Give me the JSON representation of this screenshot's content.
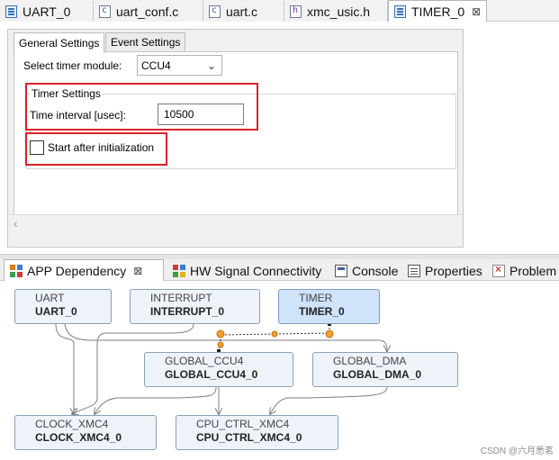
{
  "editor_tabs": [
    {
      "label": "UART_0",
      "icon": "app-icon"
    },
    {
      "label": "uart_conf.c",
      "icon": "c-file-icon"
    },
    {
      "label": "uart.c",
      "icon": "c-file-icon"
    },
    {
      "label": "xmc_usic.h",
      "icon": "h-file-icon"
    },
    {
      "label": "TIMER_0",
      "icon": "app-icon",
      "active": true,
      "close": "⊠"
    }
  ],
  "form": {
    "tabs": [
      "General Settings",
      "Event Settings"
    ],
    "timer_module_label": "Select timer module:",
    "timer_module_value": "CCU4",
    "group_title": "Timer Settings",
    "interval_label": "Time interval [usec]:",
    "interval_value": "10500",
    "start_label": "Start after initialization",
    "start_checked": false,
    "highlight_color": "#d9222a"
  },
  "view_tabs": [
    {
      "label": "APP Dependency",
      "close": "⊠",
      "icon": "app-dependency-icon",
      "active": true
    },
    {
      "label": "HW Signal Connectivity",
      "icon": "hw-signal-icon"
    },
    {
      "label": "Console",
      "icon": "console-icon"
    },
    {
      "label": "Properties",
      "icon": "properties-icon"
    },
    {
      "label": "Problem",
      "icon": "problems-icon"
    }
  ],
  "diagram": {
    "nodes": [
      {
        "type": "UART",
        "name": "UART_0"
      },
      {
        "type": "INTERRUPT",
        "name": "INTERRUPT_0"
      },
      {
        "type": "TIMER",
        "name": "TIMER_0",
        "selected": true
      },
      {
        "type": "GLOBAL_CCU4",
        "name": "GLOBAL_CCU4_0"
      },
      {
        "type": "GLOBAL_DMA",
        "name": "GLOBAL_DMA_0"
      },
      {
        "type": "CLOCK_XMC4",
        "name": "CLOCK_XMC4_0"
      },
      {
        "type": "CPU_CTRL_XMC4",
        "name": "CPU_CTRL_XMC4_0"
      }
    ],
    "edge_color": "#7f7f7f",
    "selected_edge_color": "#e08a00"
  },
  "watermark": "CSDN @六月悉茗"
}
